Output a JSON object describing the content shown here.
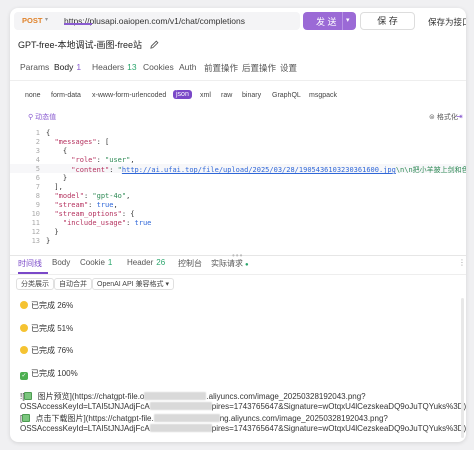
{
  "request": {
    "method": "POST",
    "url": "https://plusapi.oaiopen.com/v1/chat/completions",
    "send_label": "发 送",
    "save_label": "保 存",
    "save_as_label": "保存为接口",
    "title": "GPT-free-本地调试-画图-free站"
  },
  "tabs": [
    {
      "label": "Params",
      "count": ""
    },
    {
      "label": "Body",
      "count": "1"
    },
    {
      "label": "Headers",
      "count": "13"
    },
    {
      "label": "Cookies",
      "count": ""
    },
    {
      "label": "Auth",
      "count": ""
    },
    {
      "label": "前置操作",
      "count": ""
    },
    {
      "label": "后置操作",
      "count": ""
    },
    {
      "label": "设置",
      "count": ""
    }
  ],
  "body_types": [
    "none",
    "form-data",
    "x-www-form-urlencoded",
    "json",
    "xml",
    "raw",
    "binary",
    "GraphQL",
    "msgpack"
  ],
  "editor": {
    "dynamic_label": "动态值",
    "format_label": "格式化",
    "lines": [
      {
        "n": "1",
        "text": "{"
      },
      {
        "n": "2",
        "text": "  \"messages\": ["
      },
      {
        "n": "3",
        "text": "    {"
      },
      {
        "n": "4",
        "text": "      \"role\": \"user\","
      },
      {
        "n": "5",
        "text": "      \"content\": \"http://ai.ufai.top/file/upload/2025/03/28/1905436103230361600.jpg\\n\\n把小羊披上剑和色透明头纱\""
      },
      {
        "n": "6",
        "text": "    }"
      },
      {
        "n": "7",
        "text": "  ],"
      },
      {
        "n": "8",
        "text": "  \"model\": \"gpt-4o\","
      },
      {
        "n": "9",
        "text": "  \"stream\": true,"
      },
      {
        "n": "10",
        "text": "  \"stream_options\": {"
      },
      {
        "n": "11",
        "text": "    \"include_usage\": true"
      },
      {
        "n": "12",
        "text": "  }"
      },
      {
        "n": "13",
        "text": "}"
      }
    ]
  },
  "response_tabs": [
    {
      "label": "时间线",
      "count": ""
    },
    {
      "label": "Body",
      "count": ""
    },
    {
      "label": "Cookie",
      "count": "1"
    },
    {
      "label": "Header",
      "count": "26"
    },
    {
      "label": "控制台",
      "count": ""
    },
    {
      "label": "实际请求",
      "count": ""
    }
  ],
  "chips": [
    "分类展示",
    "自动合并",
    "OpenAI API 兼容格式"
  ],
  "output": {
    "l1": "已完成 26%",
    "l2": "已完成 51%",
    "l3": "已完成 76%",
    "l4": "已完成 100%",
    "l5a": "![",
    "l5b": " 图片预览](https://chatgpt-file.o",
    "l5c": ".aliyuncs.com/image_20250328192043.png?",
    "l6a": "OSSAccessKeyId=LTAI5tJNJAdjFcA",
    "l6b": "pires=1743765647&Signature=wOtqxU4lCezskeaDQ9oJuTQYuks%3D)",
    "l7a": "[",
    "l7b": " 点击下载图片](https://chatgpt-file.",
    "l7c": "ng.aliyuncs.com/image_20250328192043.png?",
    "l8a": "OSSAccessKeyId=LTAI5tJNJAdjFcA",
    "l8b": "pires=1743765647&Signature=wOtqxU4lCezskeaDQ9oJuTQYuks%3D)"
  }
}
